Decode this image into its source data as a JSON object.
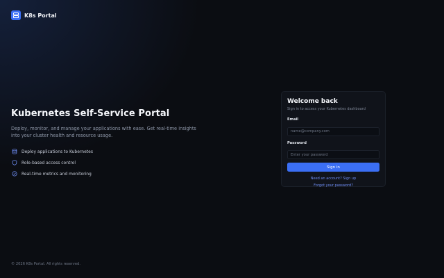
{
  "brand": {
    "name": "K8s Portal",
    "icon": "server-icon",
    "accent": "#3b6ff5"
  },
  "hero": {
    "title": "Kubernetes Self-Service Portal",
    "description": "Deploy, monitor, and manage your applications with ease. Get real-time insights into your cluster health and resource usage.",
    "features": [
      {
        "icon": "database-icon",
        "label": "Deploy applications to Kubernetes"
      },
      {
        "icon": "shield-icon",
        "label": "Role-based access control"
      },
      {
        "icon": "check-circle-icon",
        "label": "Real-time metrics and monitoring"
      }
    ]
  },
  "login": {
    "title": "Welcome back",
    "subtitle": "Sign in to access your Kubernetes dashboard",
    "email_label": "Email",
    "email_placeholder": "name@company.com",
    "password_label": "Password",
    "password_placeholder": "Enter your password",
    "signin_label": "Sign in",
    "signup_link": "Need an account? Sign up",
    "forgot_link": "Forgot your password?"
  },
  "footer": {
    "copyright": "© 2026 K8s Portal. All rights reserved."
  }
}
